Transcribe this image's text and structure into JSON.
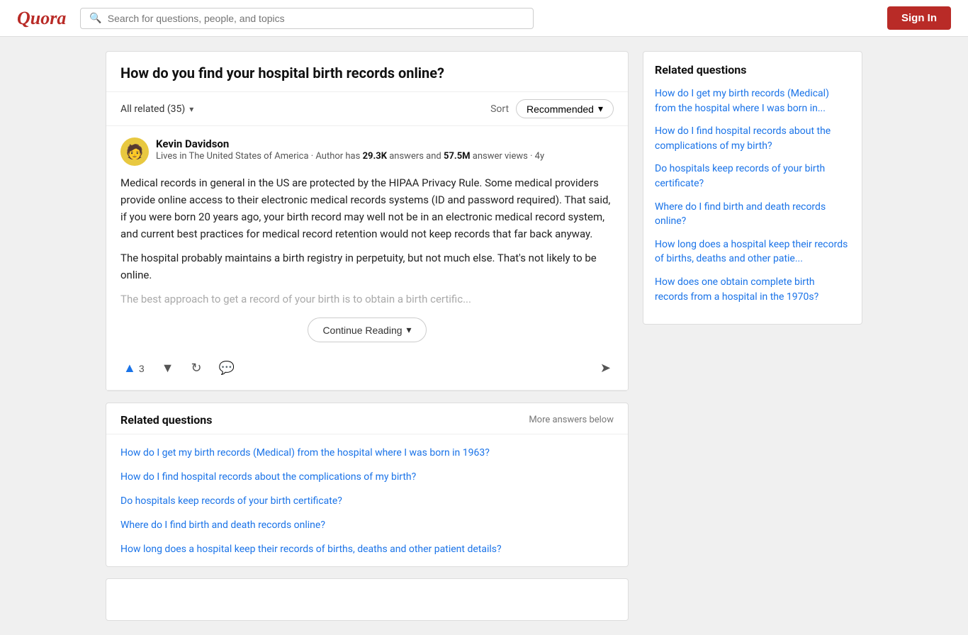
{
  "header": {
    "logo": "Quora",
    "search_placeholder": "Search for questions, people, and topics",
    "sign_in_label": "Sign In"
  },
  "question": {
    "title": "How do you find your hospital birth records online?"
  },
  "filter_bar": {
    "all_related_label": "All related (35)",
    "sort_label": "Sort",
    "recommended_label": "Recommended"
  },
  "answer": {
    "author_name": "Kevin Davidson",
    "author_bio_prefix": "Lives in The United States of America · Author has ",
    "author_answers": "29.3K",
    "author_bio_mid": " answers and ",
    "author_views": "57.5M",
    "author_bio_suffix": " answer views · 4y",
    "paragraph1": "Medical records in general in the US are protected by the HIPAA Privacy Rule. Some medical providers provide online access to their electronic medical records systems (ID and password required). That said, if you were born 20 years ago, your birth record may well not be in an electronic medical record system, and current best practices for medical record retention would not keep records that far back anyway.",
    "paragraph2": "The hospital probably maintains a birth registry in perpetuity, but not much else. That's not likely to be online.",
    "paragraph3_faded": "The best approach to get a record of your birth is to obtain a birth certific...",
    "continue_reading_label": "Continue Reading",
    "vote_count": "3",
    "upvote_icon": "▲",
    "downvote_icon": "▼",
    "reshare_icon": "↻",
    "comment_icon": "💬",
    "share_icon": "➤"
  },
  "related_inline": {
    "title": "Related questions",
    "more_label": "More answers below",
    "items": [
      {
        "text": "How do I get my birth records (Medical) from the hospital where I was born in 1963?",
        "id": "rq1"
      },
      {
        "text": "How do I find hospital records about the complications of my birth?",
        "id": "rq2"
      },
      {
        "text": "Do hospitals keep records of your birth certificate?",
        "id": "rq3"
      },
      {
        "text": "Where do I find birth and death records online?",
        "id": "rq4"
      },
      {
        "text": "How long does a hospital keep their records of births, deaths and other patient details?",
        "id": "rq5"
      }
    ]
  },
  "side_panel": {
    "title": "Related questions",
    "items": [
      {
        "text": "How do I get my birth records (Medical) from the hospital where I was born in...",
        "id": "sq1"
      },
      {
        "text": "How do I find hospital records about the complications of my birth?",
        "id": "sq2"
      },
      {
        "text": "Do hospitals keep records of your birth certificate?",
        "id": "sq3"
      },
      {
        "text": "Where do I find birth and death records online?",
        "id": "sq4"
      },
      {
        "text": "How long does a hospital keep their records of births, deaths and other patie...",
        "id": "sq5"
      },
      {
        "text": "How does one obtain complete birth records from a hospital in the 1970s?",
        "id": "sq6"
      }
    ]
  }
}
